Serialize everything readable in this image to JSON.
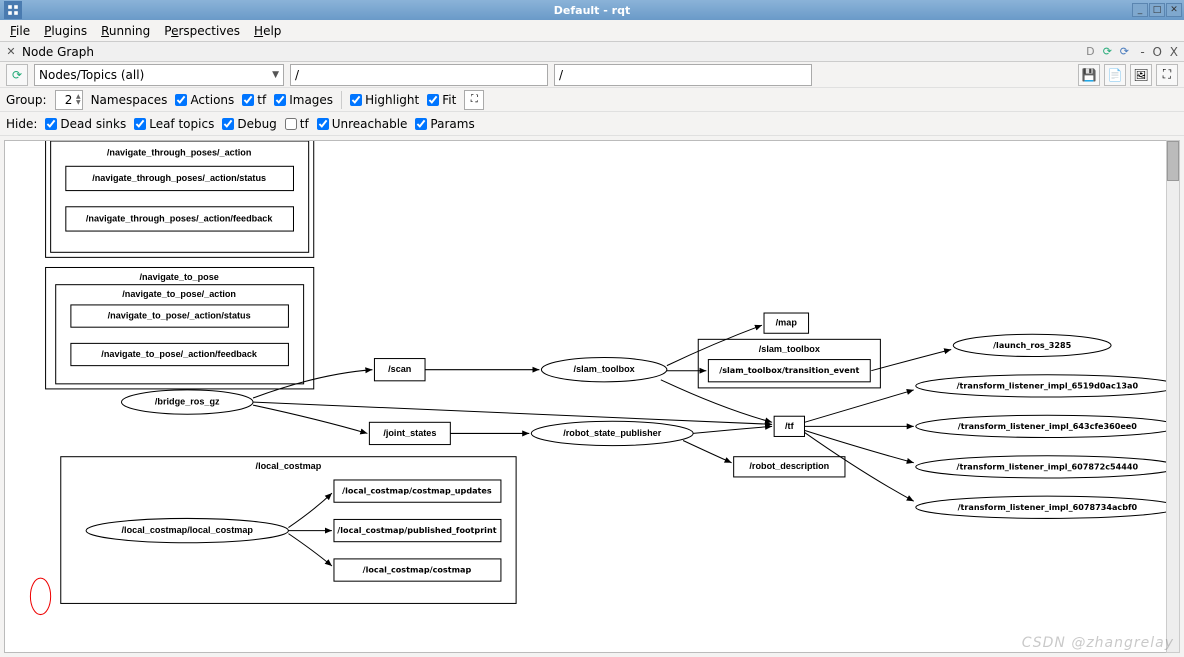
{
  "window": {
    "title": "Default - rqt"
  },
  "menu": {
    "file": "File",
    "plugins": "Plugins",
    "running": "Running",
    "perspectives": "Perspectives",
    "help": "Help"
  },
  "subwin": {
    "title": "Node Graph",
    "close_hint": "- O X"
  },
  "toolbar": {
    "combo_label": "Nodes/Topics (all)",
    "filter1": "/",
    "filter2": "/"
  },
  "row2": {
    "group_label": "Group:",
    "group_value": "2",
    "namespaces": "Namespaces",
    "actions": "Actions",
    "tf": "tf",
    "images": "Images",
    "highlight": "Highlight",
    "fit": "Fit"
  },
  "row3": {
    "hide_label": "Hide:",
    "dead_sinks": "Dead sinks",
    "leaf_topics": "Leaf topics",
    "debug": "Debug",
    "tf": "tf",
    "unreachable": "Unreachable",
    "params": "Params"
  },
  "graph": {
    "nav_through_poses_action": "/navigate_through_poses/_action",
    "nav_through_poses_status": "/navigate_through_poses/_action/status",
    "nav_through_poses_feedback": "/navigate_through_poses/_action/feedback",
    "nav_to_pose": "/navigate_to_pose",
    "nav_to_pose_action": "/navigate_to_pose/_action",
    "nav_to_pose_status": "/navigate_to_pose/_action/status",
    "nav_to_pose_feedback": "/navigate_to_pose/_action/feedback",
    "bridge": "/bridge_ros_gz",
    "scan": "/scan",
    "joint_states": "/joint_states",
    "slam_toolbox": "/slam_toolbox",
    "slam_toolbox_grp": "/slam_toolbox",
    "slam_transition": "/slam_toolbox/transition_event",
    "map": "/map",
    "robot_state_pub": "/robot_state_publisher",
    "tf": "/tf",
    "robot_desc": "/robot_description",
    "local_costmap_grp": "/local_costmap",
    "local_costmap_node": "/local_costmap/local_costmap",
    "lc_updates": "/local_costmap/costmap_updates",
    "lc_footprint": "/local_costmap/published_footprint",
    "lc_costmap": "/local_costmap/costmap",
    "launch_ros": "/launch_ros_3285",
    "tl1": "/transform_listener_impl_6519d0ac13a0",
    "tl2": "/transform_listener_impl_643cfe360ee0",
    "tl3": "/transform_listener_impl_607872c54440",
    "tl4": "/transform_listener_impl_6078734acbf0"
  },
  "watermark": "CSDN @zhangrelay"
}
